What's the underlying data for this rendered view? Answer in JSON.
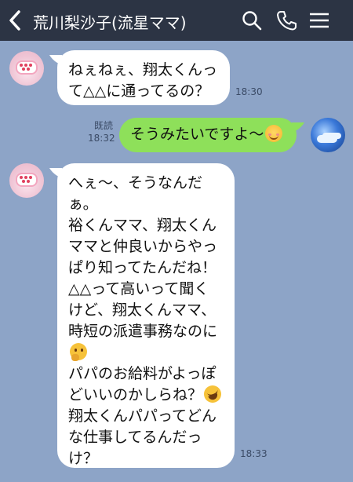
{
  "header": {
    "title": "荒川梨沙子(流星ママ)",
    "back_icon": "chevron-left-icon",
    "search_icon": "search-icon",
    "call_icon": "phone-icon",
    "menu_icon": "menu-icon"
  },
  "colors": {
    "header_bg": "#2c3444",
    "chat_bg": "#8da4c7",
    "incoming_bubble": "#ffffff",
    "outgoing_bubble": "#8ee05a"
  },
  "messages": [
    {
      "direction": "incoming",
      "lines": [
        "ねぇねぇ、翔太くんっ",
        "て△△に通ってるの？"
      ],
      "time": "18:30"
    },
    {
      "direction": "outgoing",
      "read_label": "既読",
      "text": "そうみたいですよ〜",
      "emoji": "smiling-face-icon",
      "time": "18:32"
    },
    {
      "direction": "incoming",
      "lines": [
        "へぇ〜、そうなんだ",
        "ぁ。",
        "裕くんママ、翔太くん",
        "ママと仲良いからやっ",
        "ぱり知ってたんだね！",
        "△△って高いって聞く",
        "けど、翔太くんママ、",
        "時短の派遣事務なのに",
        "",
        "パパのお給料がよっぽ",
        "どいいのかしらね？",
        "翔太くんパパってどん",
        "な仕事してるんだっ",
        "け？"
      ],
      "emojis": [
        "thinking-face-icon",
        "rolling-laughing-face-icon"
      ],
      "time": "18:33"
    }
  ]
}
